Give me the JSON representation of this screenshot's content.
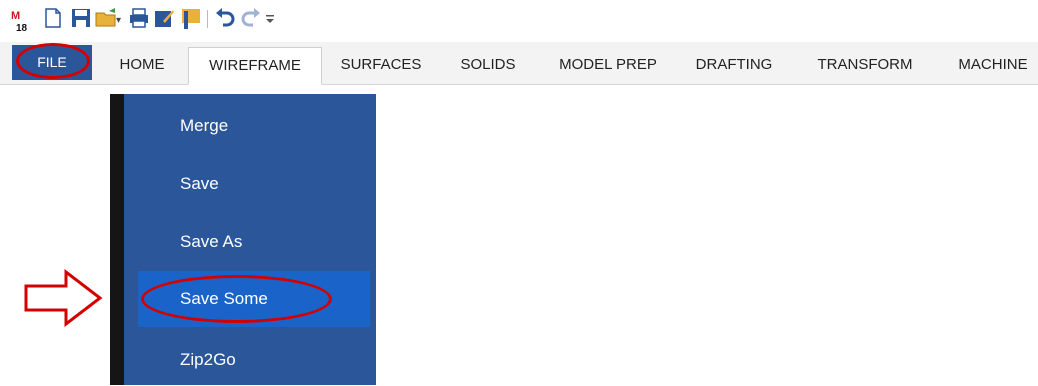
{
  "quick_access": {
    "icons": [
      "app-logo-icon",
      "new-file-icon",
      "save-icon",
      "open-icon",
      "print-icon",
      "edit-icon",
      "bookmark-icon",
      "undo-icon",
      "redo-icon",
      "customize-dropdown-icon"
    ]
  },
  "ribbon": {
    "file_label": "FILE",
    "tabs": [
      "HOME",
      "WIREFRAME",
      "SURFACES",
      "SOLIDS",
      "MODEL PREP",
      "DRAFTING",
      "TRANSFORM",
      "MACHINE"
    ],
    "active_tab": "WIREFRAME"
  },
  "backstage": {
    "items": [
      "Merge",
      "Save",
      "Save As",
      "Save Some",
      "Zip2Go"
    ],
    "selected_item": "Save Some"
  },
  "colors": {
    "ribbon_blue": "#2b579a",
    "selected_blue": "#1a63c8",
    "highlight_red": "#d40000"
  }
}
